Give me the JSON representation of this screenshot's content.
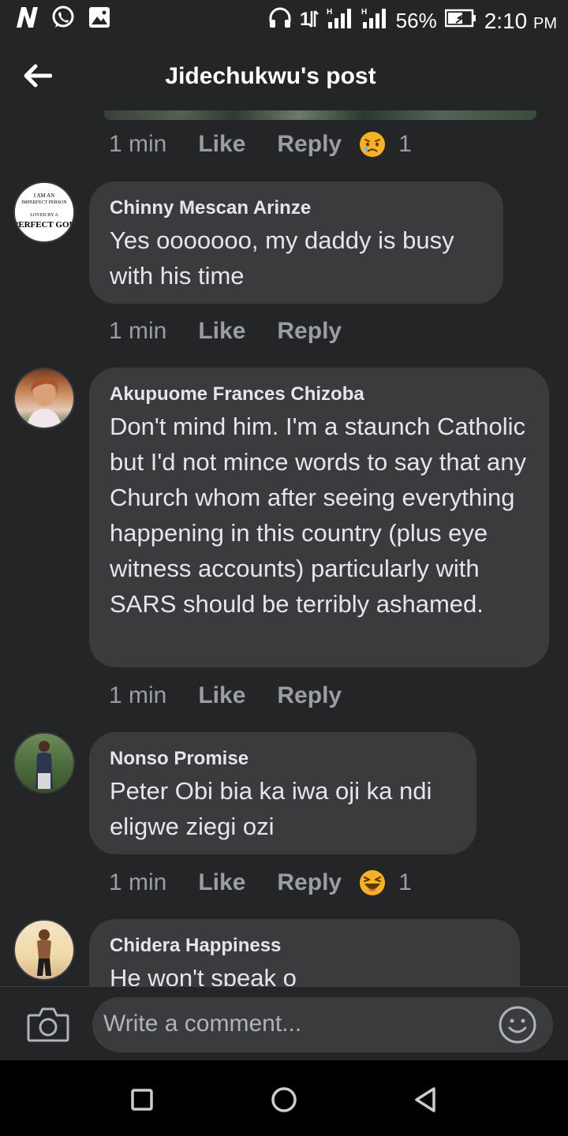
{
  "status_bar": {
    "battery_percent": "56%",
    "time": "2:10",
    "ampm": "PM",
    "network_label": "H",
    "icons": [
      "n-app-icon",
      "whatsapp-icon",
      "gallery-icon",
      "headphones-icon",
      "data-transfer-icon",
      "signal-icon",
      "signal-icon",
      "battery-icon"
    ]
  },
  "header": {
    "title": "Jidechukwu's post"
  },
  "comments": [
    {
      "time": "1 min",
      "like": "Like",
      "reply": "Reply",
      "reaction": "sad-emoji",
      "reaction_count": "1"
    },
    {
      "author": "Chinny Mescan Arinze",
      "text": "Yes ooooooo, my daddy is busy with his time",
      "avatar_text": [
        "I AM AN",
        "IMPERFECT PERSON",
        "LOVED BY A",
        "PERFECT GOD"
      ],
      "time": "1 min",
      "like": "Like",
      "reply": "Reply"
    },
    {
      "author": "Akupuome Frances Chizoba",
      "text": "Don't mind him. I'm a staunch Catholic but I'd not mince words to say that any Church whom after seeing everything happening in this country (plus eye witness accounts) particularly with SARS should be terribly ashamed.",
      "time": "1 min",
      "like": "Like",
      "reply": "Reply"
    },
    {
      "author": "Nonso Promise",
      "text": "Peter Obi bia ka iwa oji ka ndi eligwe ziegi ozi",
      "time": "1 min",
      "like": "Like",
      "reply": "Reply",
      "reaction": "laughing-emoji",
      "reaction_count": "1"
    },
    {
      "author": "Chidera Happiness",
      "text": "He won't speak o"
    }
  ],
  "input": {
    "placeholder": "Write a comment..."
  },
  "colors": {
    "background": "#242526",
    "bubble": "#3a3b3c",
    "text": "#e4e6eb",
    "meta": "#9a9da2",
    "reaction_yellow": "#f7b125"
  }
}
